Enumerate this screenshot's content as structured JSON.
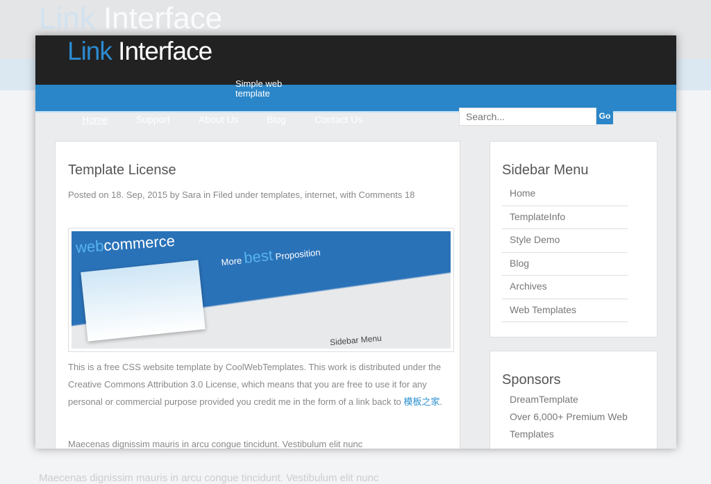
{
  "site": {
    "logo_a": "Link",
    "logo_b": " Interface",
    "slogan": "Simple web template"
  },
  "nav": [
    "Home",
    "Support",
    "About Us",
    "Blog",
    "Contact Us"
  ],
  "search": {
    "placeholder": "Search...",
    "go_label": "Go"
  },
  "post": {
    "title": "Template License",
    "meta": "Posted on 18. Sep, 2015 by Sara in Filed under templates, internet, with Comments 18",
    "image": {
      "brand_a": "web",
      "brand_b": "commerce",
      "headline_a": "More ",
      "headline_b": "best",
      "headline_c": " Proposition",
      "sidebar_label": "Sidebar Menu"
    },
    "body": "This is a free CSS website template by CoolWebTemplates. This work is distributed under the Creative Commons Attribution 3.0 License, which means that you are free to use it for any personal or commercial purpose provided you credit me in the form of a link back to ",
    "link": "模板之家",
    "after_link": ".",
    "body2": "Maecenas dignissim mauris in arcu congue tincidunt. Vestibulum elit nunc"
  },
  "sidebar": {
    "title": "Sidebar Menu",
    "items": [
      "Home",
      "TemplateInfo",
      "Style Demo",
      "Blog",
      "Archives",
      "Web Templates"
    ]
  },
  "sponsors": {
    "title": "Sponsors",
    "items": [
      "DreamTemplate",
      "Over 6,000+ Premium Web Templates"
    ]
  },
  "colors": {
    "accent": "#2a86c8",
    "header": "#222222"
  }
}
